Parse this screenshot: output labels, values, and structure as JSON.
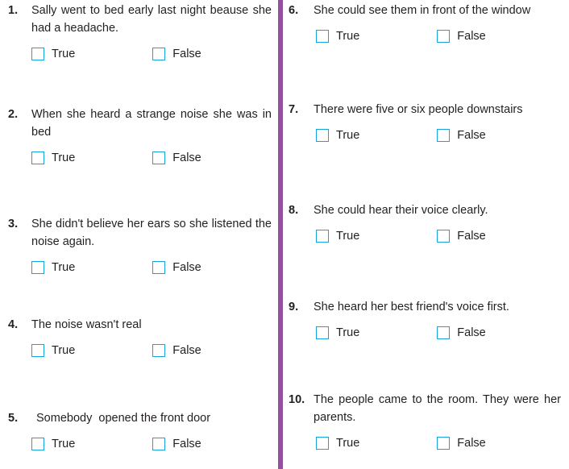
{
  "theme": {
    "divider_color": "#94519B",
    "checkbox_border_color": "#17a3dd",
    "text_color": "#231f20",
    "background_color": "#ffffff"
  },
  "options": {
    "true_label": "True",
    "false_label": "False"
  },
  "left_column": {
    "questions": [
      {
        "number": "1.",
        "text": "Sally went to bed early last night beause she had a headache.",
        "true_label": "True",
        "false_label": "False"
      },
      {
        "number": "2.",
        "text": "When she heard a strange noise she was in bed",
        "true_label": "True",
        "false_label": "False"
      },
      {
        "number": "3.",
        "text": "She didn't believe her ears so she listened the noise again.",
        "true_label": "True",
        "false_label": "False"
      },
      {
        "number": "4.",
        "text": "The noise wasn't real",
        "true_label": "True",
        "false_label": "False"
      },
      {
        "number": "5.",
        "text": "Somebody  opened the front door",
        "true_label": "True",
        "false_label": "False"
      }
    ]
  },
  "right_column": {
    "questions": [
      {
        "number": "6.",
        "text": "She could see them in front of the window",
        "true_label": "True",
        "false_label": "False"
      },
      {
        "number": "7.",
        "text": "There were five or six people downstairs",
        "true_label": "True",
        "false_label": "False"
      },
      {
        "number": "8.",
        "text": "She could hear their voice clearly.",
        "true_label": "True",
        "false_label": "False"
      },
      {
        "number": "9.",
        "text": "She heard her best friend's voice first.",
        "true_label": "True",
        "false_label": "False"
      },
      {
        "number": "10.",
        "text": "The people came to the room. They were her parents.",
        "true_label": "True",
        "false_label": "False"
      }
    ]
  }
}
